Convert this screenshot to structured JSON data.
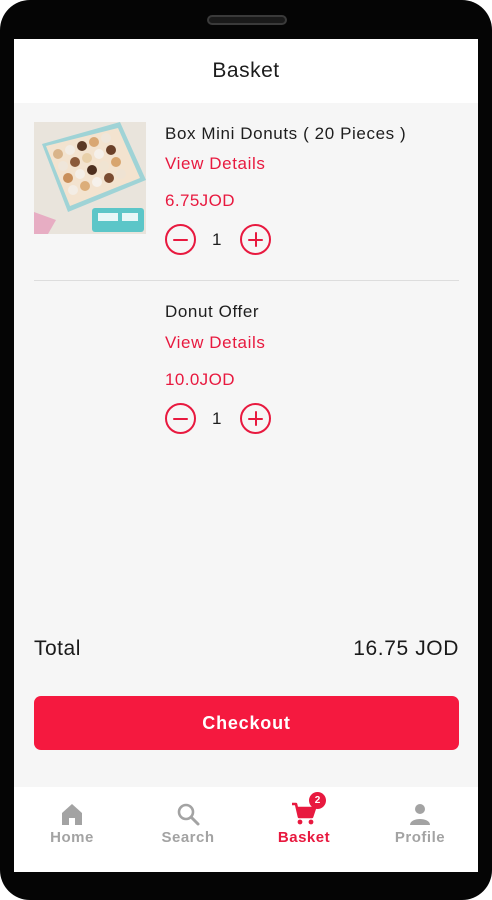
{
  "header": {
    "title": "Basket"
  },
  "items": [
    {
      "name": "Box Mini Donuts  ( 20 Pieces )",
      "view_details": "View Details",
      "price": "6.75JOD",
      "quantity": "1",
      "has_image": true
    },
    {
      "name": "Donut Offer",
      "view_details": "View Details",
      "price": "10.0JOD",
      "quantity": "1",
      "has_image": false
    }
  ],
  "summary": {
    "total_label": "Total",
    "total_value": "16.75 JOD"
  },
  "checkout": {
    "label": "Checkout"
  },
  "tabbar": {
    "tabs": [
      {
        "label": "Home",
        "icon": "home-icon",
        "active": false
      },
      {
        "label": "Search",
        "icon": "search-icon",
        "active": false
      },
      {
        "label": "Basket",
        "icon": "cart-icon",
        "active": true,
        "badge": "2"
      },
      {
        "label": "Profile",
        "icon": "person-icon",
        "active": false
      }
    ]
  },
  "colors": {
    "accent": "#e8193f",
    "button": "#f5193f",
    "inactive": "#a3a3a3",
    "background": "#f6f6f6"
  }
}
